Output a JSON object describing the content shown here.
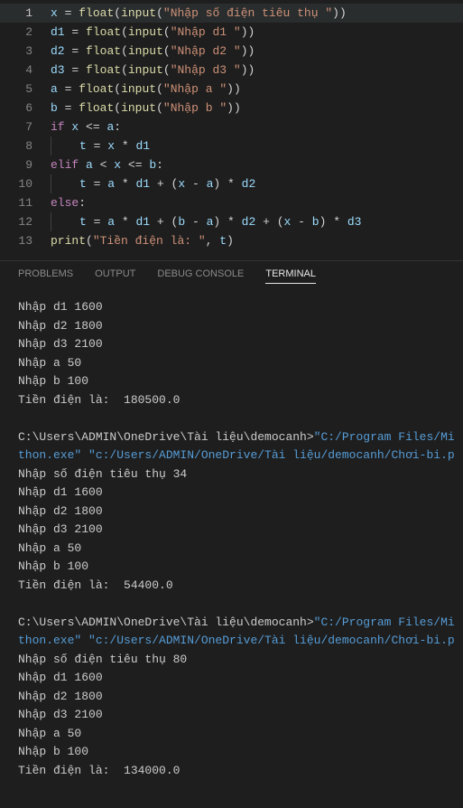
{
  "editor": {
    "lines": [
      {
        "n": 1,
        "active": true,
        "indent": 0,
        "tokens": [
          [
            "v",
            "x"
          ],
          [
            "p",
            " "
          ],
          [
            "p",
            "="
          ],
          [
            "p",
            " "
          ],
          [
            "f",
            "float"
          ],
          [
            "p",
            "("
          ],
          [
            "f",
            "input"
          ],
          [
            "p",
            "("
          ],
          [
            "s",
            "\"Nhập số điện tiêu thụ \""
          ],
          [
            "p",
            ")"
          ],
          [
            "p",
            ")"
          ]
        ]
      },
      {
        "n": 2,
        "indent": 0,
        "tokens": [
          [
            "v",
            "d1"
          ],
          [
            "p",
            " "
          ],
          [
            "p",
            "="
          ],
          [
            "p",
            " "
          ],
          [
            "f",
            "float"
          ],
          [
            "p",
            "("
          ],
          [
            "f",
            "input"
          ],
          [
            "p",
            "("
          ],
          [
            "s",
            "\"Nhập d1 \""
          ],
          [
            "p",
            ")"
          ],
          [
            "p",
            ")"
          ]
        ]
      },
      {
        "n": 3,
        "indent": 0,
        "tokens": [
          [
            "v",
            "d2"
          ],
          [
            "p",
            " "
          ],
          [
            "p",
            "="
          ],
          [
            "p",
            " "
          ],
          [
            "f",
            "float"
          ],
          [
            "p",
            "("
          ],
          [
            "f",
            "input"
          ],
          [
            "p",
            "("
          ],
          [
            "s",
            "\"Nhập d2 \""
          ],
          [
            "p",
            ")"
          ],
          [
            "p",
            ")"
          ]
        ]
      },
      {
        "n": 4,
        "indent": 0,
        "tokens": [
          [
            "v",
            "d3"
          ],
          [
            "p",
            " "
          ],
          [
            "p",
            "="
          ],
          [
            "p",
            " "
          ],
          [
            "f",
            "float"
          ],
          [
            "p",
            "("
          ],
          [
            "f",
            "input"
          ],
          [
            "p",
            "("
          ],
          [
            "s",
            "\"Nhập d3 \""
          ],
          [
            "p",
            ")"
          ],
          [
            "p",
            ")"
          ]
        ]
      },
      {
        "n": 5,
        "indent": 0,
        "tokens": [
          [
            "v",
            "a"
          ],
          [
            "p",
            " "
          ],
          [
            "p",
            "="
          ],
          [
            "p",
            " "
          ],
          [
            "f",
            "float"
          ],
          [
            "p",
            "("
          ],
          [
            "f",
            "input"
          ],
          [
            "p",
            "("
          ],
          [
            "s",
            "\"Nhập a \""
          ],
          [
            "p",
            ")"
          ],
          [
            "p",
            ")"
          ]
        ]
      },
      {
        "n": 6,
        "indent": 0,
        "tokens": [
          [
            "v",
            "b"
          ],
          [
            "p",
            " "
          ],
          [
            "p",
            "="
          ],
          [
            "p",
            " "
          ],
          [
            "f",
            "float"
          ],
          [
            "p",
            "("
          ],
          [
            "f",
            "input"
          ],
          [
            "p",
            "("
          ],
          [
            "s",
            "\"Nhập b \""
          ],
          [
            "p",
            ")"
          ],
          [
            "p",
            ")"
          ]
        ]
      },
      {
        "n": 7,
        "indent": 0,
        "tokens": [
          [
            "kw",
            "if"
          ],
          [
            "p",
            " "
          ],
          [
            "v",
            "x"
          ],
          [
            "p",
            " "
          ],
          [
            "p",
            "<="
          ],
          [
            "p",
            " "
          ],
          [
            "v",
            "a"
          ],
          [
            "p",
            ":"
          ]
        ]
      },
      {
        "n": 8,
        "indent": 1,
        "tokens": [
          [
            "v",
            "t"
          ],
          [
            "p",
            " "
          ],
          [
            "p",
            "="
          ],
          [
            "p",
            " "
          ],
          [
            "v",
            "x"
          ],
          [
            "p",
            " "
          ],
          [
            "p",
            "*"
          ],
          [
            "p",
            " "
          ],
          [
            "v",
            "d1"
          ]
        ]
      },
      {
        "n": 9,
        "indent": 0,
        "tokens": [
          [
            "kw",
            "elif"
          ],
          [
            "p",
            " "
          ],
          [
            "v",
            "a"
          ],
          [
            "p",
            " "
          ],
          [
            "p",
            "<"
          ],
          [
            "p",
            " "
          ],
          [
            "v",
            "x"
          ],
          [
            "p",
            " "
          ],
          [
            "p",
            "<="
          ],
          [
            "p",
            " "
          ],
          [
            "v",
            "b"
          ],
          [
            "p",
            ":"
          ]
        ]
      },
      {
        "n": 10,
        "indent": 1,
        "tokens": [
          [
            "v",
            "t"
          ],
          [
            "p",
            " "
          ],
          [
            "p",
            "="
          ],
          [
            "p",
            " "
          ],
          [
            "v",
            "a"
          ],
          [
            "p",
            " "
          ],
          [
            "p",
            "*"
          ],
          [
            "p",
            " "
          ],
          [
            "v",
            "d1"
          ],
          [
            "p",
            " "
          ],
          [
            "p",
            "+"
          ],
          [
            "p",
            " "
          ],
          [
            "p",
            "("
          ],
          [
            "v",
            "x"
          ],
          [
            "p",
            " "
          ],
          [
            "p",
            "-"
          ],
          [
            "p",
            " "
          ],
          [
            "v",
            "a"
          ],
          [
            "p",
            ")"
          ],
          [
            "p",
            " "
          ],
          [
            "p",
            "*"
          ],
          [
            "p",
            " "
          ],
          [
            "v",
            "d2"
          ]
        ]
      },
      {
        "n": 11,
        "indent": 0,
        "tokens": [
          [
            "kw",
            "else"
          ],
          [
            "p",
            ":"
          ]
        ]
      },
      {
        "n": 12,
        "indent": 1,
        "tokens": [
          [
            "v",
            "t"
          ],
          [
            "p",
            " "
          ],
          [
            "p",
            "="
          ],
          [
            "p",
            " "
          ],
          [
            "v",
            "a"
          ],
          [
            "p",
            " "
          ],
          [
            "p",
            "*"
          ],
          [
            "p",
            " "
          ],
          [
            "v",
            "d1"
          ],
          [
            "p",
            " "
          ],
          [
            "p",
            "+"
          ],
          [
            "p",
            " "
          ],
          [
            "p",
            "("
          ],
          [
            "v",
            "b"
          ],
          [
            "p",
            " "
          ],
          [
            "p",
            "-"
          ],
          [
            "p",
            " "
          ],
          [
            "v",
            "a"
          ],
          [
            "p",
            ")"
          ],
          [
            "p",
            " "
          ],
          [
            "p",
            "*"
          ],
          [
            "p",
            " "
          ],
          [
            "v",
            "d2"
          ],
          [
            "p",
            " "
          ],
          [
            "p",
            "+"
          ],
          [
            "p",
            " "
          ],
          [
            "p",
            "("
          ],
          [
            "v",
            "x"
          ],
          [
            "p",
            " "
          ],
          [
            "p",
            "-"
          ],
          [
            "p",
            " "
          ],
          [
            "v",
            "b"
          ],
          [
            "p",
            ")"
          ],
          [
            "p",
            " "
          ],
          [
            "p",
            "*"
          ],
          [
            "p",
            " "
          ],
          [
            "v",
            "d3"
          ]
        ]
      },
      {
        "n": 13,
        "indent": 0,
        "tokens": [
          [
            "f",
            "print"
          ],
          [
            "p",
            "("
          ],
          [
            "s",
            "\"Tiền điện là: \""
          ],
          [
            "p",
            ","
          ],
          [
            "p",
            " "
          ],
          [
            "v",
            "t"
          ],
          [
            "p",
            ")"
          ]
        ]
      }
    ]
  },
  "panel": {
    "tabs": [
      {
        "label": "PROBLEMS",
        "active": false
      },
      {
        "label": "OUTPUT",
        "active": false
      },
      {
        "label": "DEBUG CONSOLE",
        "active": false
      },
      {
        "label": "TERMINAL",
        "active": true
      }
    ]
  },
  "terminal": {
    "lines": [
      {
        "t": "Nhập d1 1600"
      },
      {
        "t": "Nhập d2 1800"
      },
      {
        "t": "Nhập d3 2100"
      },
      {
        "t": "Nhập a 50"
      },
      {
        "t": "Nhập b 100"
      },
      {
        "t": "Tiền điện là:  180500.0"
      },
      {
        "t": ""
      },
      {
        "segs": [
          [
            "p",
            "C:\\Users\\ADMIN\\OneDrive\\Tài liệu\\democanh>"
          ],
          [
            "tc",
            "\"C:/Program Files/Mi"
          ]
        ]
      },
      {
        "segs": [
          [
            "tc",
            "thon.exe\" \"c:/Users/ADMIN/OneDrive/Tài liệu/democanh/Chơi-bi.p"
          ]
        ]
      },
      {
        "t": "Nhập số điện tiêu thụ 34"
      },
      {
        "t": "Nhập d1 1600"
      },
      {
        "t": "Nhập d2 1800"
      },
      {
        "t": "Nhập d3 2100"
      },
      {
        "t": "Nhập a 50"
      },
      {
        "t": "Nhập b 100"
      },
      {
        "t": "Tiền điện là:  54400.0"
      },
      {
        "t": ""
      },
      {
        "segs": [
          [
            "p",
            "C:\\Users\\ADMIN\\OneDrive\\Tài liệu\\democanh>"
          ],
          [
            "tc",
            "\"C:/Program Files/Mi"
          ]
        ]
      },
      {
        "segs": [
          [
            "tc",
            "thon.exe\" \"c:/Users/ADMIN/OneDrive/Tài liệu/democanh/Chơi-bi.p"
          ]
        ]
      },
      {
        "t": "Nhập số điện tiêu thụ 80"
      },
      {
        "t": "Nhập d1 1600"
      },
      {
        "t": "Nhập d2 1800"
      },
      {
        "t": "Nhập d3 2100"
      },
      {
        "t": "Nhập a 50"
      },
      {
        "t": "Nhập b 100"
      },
      {
        "t": "Tiền điện là:  134000.0"
      }
    ]
  }
}
